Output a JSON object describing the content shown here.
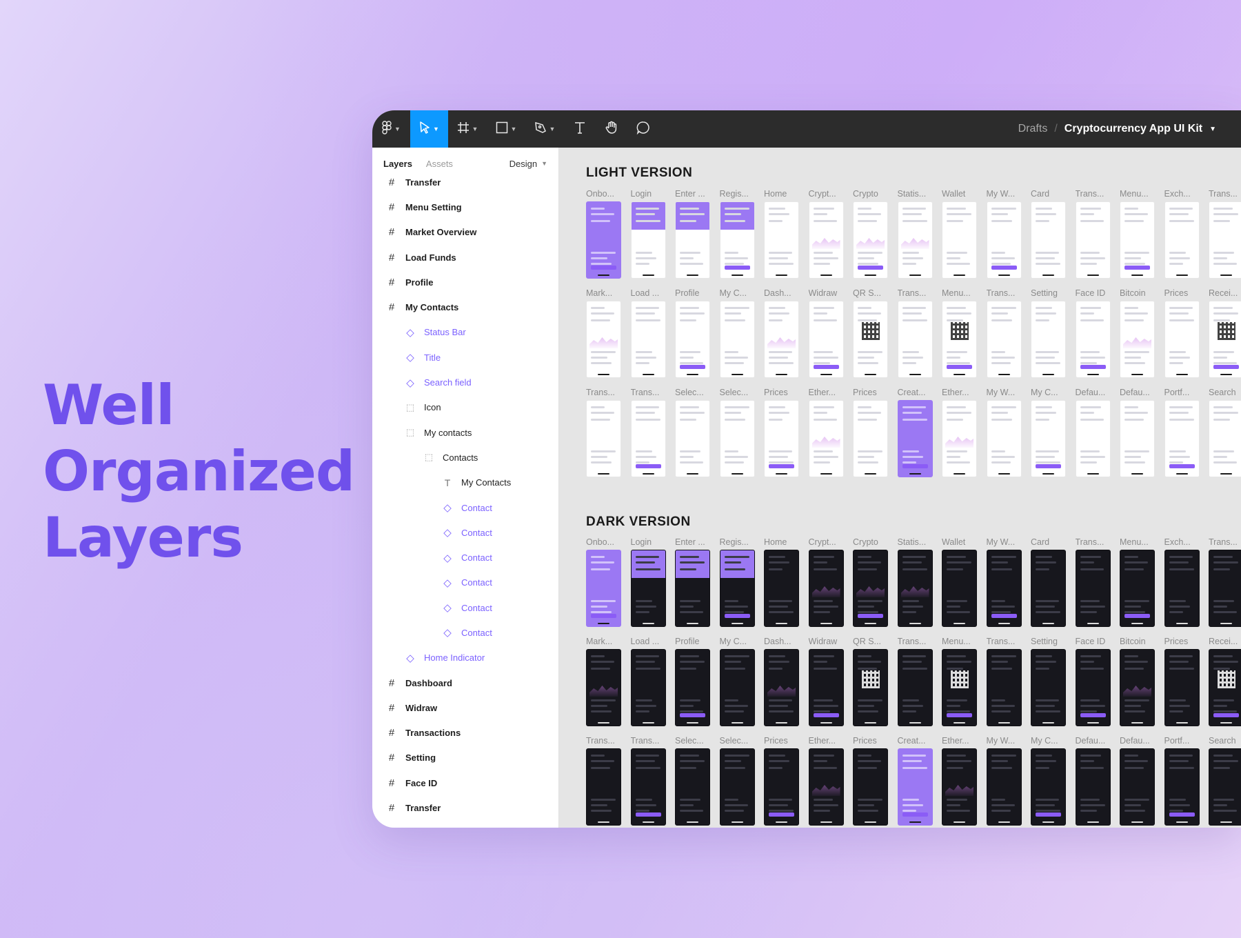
{
  "headline": [
    "Well",
    "Organized",
    "Layers"
  ],
  "toolbar": {
    "icons": [
      "figma-logo-icon",
      "move-icon",
      "frame-icon",
      "rectangle-icon",
      "pen-icon",
      "text-icon",
      "hand-icon",
      "comment-icon"
    ],
    "breadcrumb": {
      "folder": "Drafts",
      "separator": "/",
      "file": "Cryptocurrency App UI Kit"
    },
    "accent": "#0d99ff"
  },
  "layers_panel": {
    "tabs": [
      "Layers",
      "Assets"
    ],
    "design_label": "Design",
    "items": [
      {
        "label": "Transfer",
        "type": "frame",
        "depth": 0
      },
      {
        "label": "Menu Setting",
        "type": "frame",
        "depth": 0
      },
      {
        "label": "Market Overview",
        "type": "frame",
        "depth": 0
      },
      {
        "label": "Load Funds",
        "type": "frame",
        "depth": 0
      },
      {
        "label": "Profile",
        "type": "frame",
        "depth": 0
      },
      {
        "label": "My Contacts",
        "type": "frame",
        "depth": 0
      },
      {
        "label": "Status Bar",
        "type": "comp",
        "depth": 1
      },
      {
        "label": "Title",
        "type": "comp",
        "depth": 1
      },
      {
        "label": "Search field",
        "type": "comp",
        "depth": 1
      },
      {
        "label": "Icon",
        "type": "group",
        "depth": 1
      },
      {
        "label": "My contacts",
        "type": "group",
        "depth": 1
      },
      {
        "label": "Contacts",
        "type": "group",
        "depth": 2
      },
      {
        "label": "My Contacts",
        "type": "text",
        "depth": 3
      },
      {
        "label": "Contact",
        "type": "comp",
        "depth": 3
      },
      {
        "label": "Contact",
        "type": "comp",
        "depth": 3
      },
      {
        "label": "Contact",
        "type": "comp",
        "depth": 3
      },
      {
        "label": "Contact",
        "type": "comp",
        "depth": 3
      },
      {
        "label": "Contact",
        "type": "comp",
        "depth": 3
      },
      {
        "label": "Contact",
        "type": "comp",
        "depth": 3
      },
      {
        "label": "Home Indicator",
        "type": "comp",
        "depth": 1
      },
      {
        "label": "Dashboard",
        "type": "frame",
        "depth": 0
      },
      {
        "label": "Widraw",
        "type": "frame",
        "depth": 0
      },
      {
        "label": "Transactions",
        "type": "frame",
        "depth": 0
      },
      {
        "label": "Setting",
        "type": "frame",
        "depth": 0
      },
      {
        "label": "Face ID",
        "type": "frame",
        "depth": 0
      },
      {
        "label": "Transfer",
        "type": "frame",
        "depth": 0
      }
    ]
  },
  "canvas": {
    "sections": [
      {
        "title": "LIGHT VERSION",
        "theme": "light",
        "rows": [
          [
            "Onbo...",
            "Login",
            "Enter ...",
            "Regis...",
            "Home",
            "Crypt...",
            "Crypto",
            "Statis...",
            "Wallet",
            "My W...",
            "Card",
            "Trans...",
            "Menu...",
            "Exch...",
            "Trans..."
          ],
          [
            "Mark...",
            "Load ...",
            "Profile",
            "My C...",
            "Dash...",
            "Widraw",
            "QR S...",
            "Trans...",
            "Menu...",
            "Trans...",
            "Setting",
            "Face ID",
            "Bitcoin",
            "Prices",
            "Recei..."
          ],
          [
            "Trans...",
            "Trans...",
            "Selec...",
            "Selec...",
            "Prices",
            "Ether...",
            "Prices",
            "Creat...",
            "Ether...",
            "My W...",
            "My C...",
            "Defau...",
            "Defau...",
            "Portf...",
            "Search"
          ]
        ]
      },
      {
        "title": "DARK VERSION",
        "theme": "dark",
        "rows": [
          [
            "Onbo...",
            "Login",
            "Enter ...",
            "Regis...",
            "Home",
            "Crypt...",
            "Crypto",
            "Statis...",
            "Wallet",
            "My W...",
            "Card",
            "Trans...",
            "Menu...",
            "Exch...",
            "Trans..."
          ],
          [
            "Mark...",
            "Load ...",
            "Profile",
            "My C...",
            "Dash...",
            "Widraw",
            "QR S...",
            "Trans...",
            "Menu...",
            "Trans...",
            "Setting",
            "Face ID",
            "Bitcoin",
            "Prices",
            "Recei..."
          ],
          [
            "Trans...",
            "Trans...",
            "Selec...",
            "Selec...",
            "Prices",
            "Ether...",
            "Prices",
            "Creat...",
            "Ether...",
            "My W...",
            "My C...",
            "Defau...",
            "Defau...",
            "Portf...",
            "Search"
          ]
        ]
      }
    ]
  }
}
